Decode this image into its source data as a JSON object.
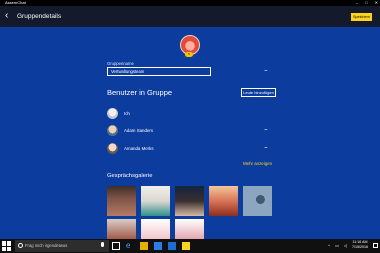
{
  "app": {
    "title": "AssemChat"
  },
  "header": {
    "title": "Gruppendetails",
    "save_label": "Speichern",
    "back_icon": "back-arrow-icon"
  },
  "group": {
    "name_label": "Gruppenname",
    "name_value": "Vertwaltungsteam",
    "more_label": "..."
  },
  "members": {
    "section_title": "Benutzer in Gruppe",
    "add_label": "Leute hinzufügen",
    "items": [
      {
        "name": "Ich",
        "more": ""
      },
      {
        "name": "Adam Sanders",
        "more": "..."
      },
      {
        "name": "Amanda Merks",
        "more": "..."
      }
    ],
    "show_more": "Mehr anzeigen"
  },
  "gallery": {
    "title": "Gesprächsgalerie",
    "thumb_colors": [
      "#b67a66",
      "#f0efe9",
      "#12233f",
      "#d87458",
      "#8ba6be",
      "#d8cfc6",
      "#ffffff",
      "#ffffff"
    ]
  },
  "taskbar": {
    "search_placeholder": "Frag mich irgendetwas",
    "time": "11:16 AM",
    "date": "7/15/2016"
  }
}
